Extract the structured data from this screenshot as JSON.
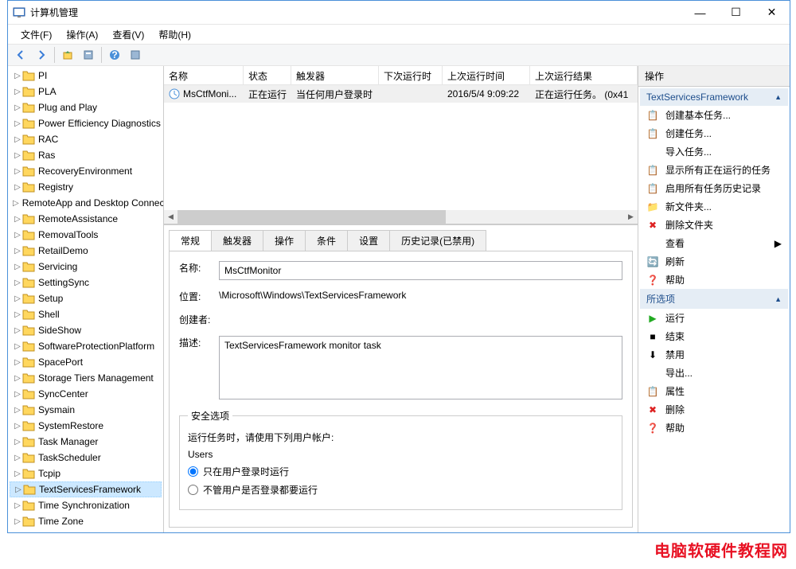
{
  "window": {
    "title": "计算机管理"
  },
  "menu": {
    "file": "文件(F)",
    "action": "操作(A)",
    "view": "查看(V)",
    "help": "帮助(H)"
  },
  "tree": {
    "items": [
      "PI",
      "PLA",
      "Plug and Play",
      "Power Efficiency Diagnostics",
      "RAC",
      "Ras",
      "RecoveryEnvironment",
      "Registry",
      "RemoteApp and Desktop Connections",
      "RemoteAssistance",
      "RemovalTools",
      "RetailDemo",
      "Servicing",
      "SettingSync",
      "Setup",
      "Shell",
      "SideShow",
      "SoftwareProtectionPlatform",
      "SpacePort",
      "Storage Tiers Management",
      "SyncCenter",
      "Sysmain",
      "SystemRestore",
      "Task Manager",
      "TaskScheduler",
      "Tcpip",
      "TextServicesFramework",
      "Time Synchronization",
      "Time Zone"
    ],
    "selected": "TextServicesFramework"
  },
  "taskList": {
    "columns": {
      "name": "名称",
      "status": "状态",
      "triggers": "触发器",
      "nextRun": "下次运行时间",
      "lastRun": "上次运行时间",
      "lastResult": "上次运行结果"
    },
    "rows": [
      {
        "name": "MsCtfMoni...",
        "status": "正在运行",
        "triggers": "当任何用户登录时",
        "nextRun": "",
        "lastRun": "2016/5/4 9:09:22",
        "lastResult": "正在运行任务。 (0x41"
      }
    ]
  },
  "tabs": {
    "general": "常规",
    "triggers": "触发器",
    "actions": "操作",
    "conditions": "条件",
    "settings": "设置",
    "history": "历史记录(已禁用)"
  },
  "detail": {
    "labels": {
      "name": "名称:",
      "location": "位置:",
      "author": "创建者:",
      "description": "描述:"
    },
    "name": "MsCtfMonitor",
    "location": "\\Microsoft\\Windows\\TextServicesFramework",
    "author": "",
    "description": "TextServicesFramework monitor task",
    "security": {
      "legend": "安全选项",
      "runAs": "运行任务时，请使用下列用户帐户:",
      "user": "Users",
      "opt1": "只在用户登录时运行",
      "opt2": "不管用户是否登录都要运行"
    }
  },
  "actions": {
    "header": "操作",
    "section1": {
      "title": "TextServicesFramework",
      "items": [
        "创建基本任务...",
        "创建任务...",
        "导入任务...",
        "显示所有正在运行的任务",
        "启用所有任务历史记录",
        "新文件夹...",
        "删除文件夹",
        "查看",
        "刷新",
        "帮助"
      ]
    },
    "section2": {
      "title": "所选项",
      "items": [
        "运行",
        "结束",
        "禁用",
        "导出...",
        "属性",
        "删除",
        "帮助"
      ]
    }
  },
  "watermark": "电脑软硬件教程网"
}
